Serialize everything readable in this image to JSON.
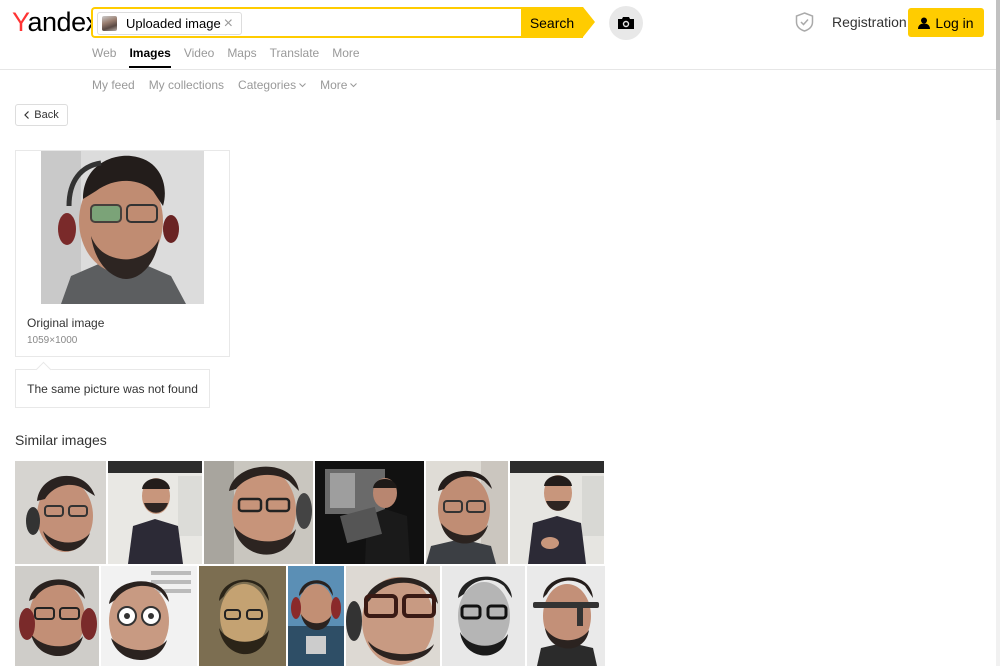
{
  "header": {
    "logo": "Yandex",
    "search_chip": "Uploaded image",
    "search_button": "Search",
    "registration": "Registration",
    "login": "Log in"
  },
  "tabs": [
    {
      "label": "Web",
      "active": false
    },
    {
      "label": "Images",
      "active": true
    },
    {
      "label": "Video",
      "active": false
    },
    {
      "label": "Maps",
      "active": false
    },
    {
      "label": "Translate",
      "active": false
    },
    {
      "label": "More",
      "active": false
    }
  ],
  "subnav": [
    "My feed",
    "My collections",
    "Categories",
    "More"
  ],
  "back_label": "Back",
  "original": {
    "label": "Original image",
    "size": "1059×1000"
  },
  "not_found": "The same picture was not found",
  "similar_title": "Similar images",
  "colors": {
    "accent": "#ffcc00",
    "logo_red": "#ff3333"
  },
  "icons": {
    "camera": "camera-icon",
    "shield": "shield-icon",
    "user": "user-icon",
    "back": "chevron-left-icon",
    "close": "close-icon"
  }
}
